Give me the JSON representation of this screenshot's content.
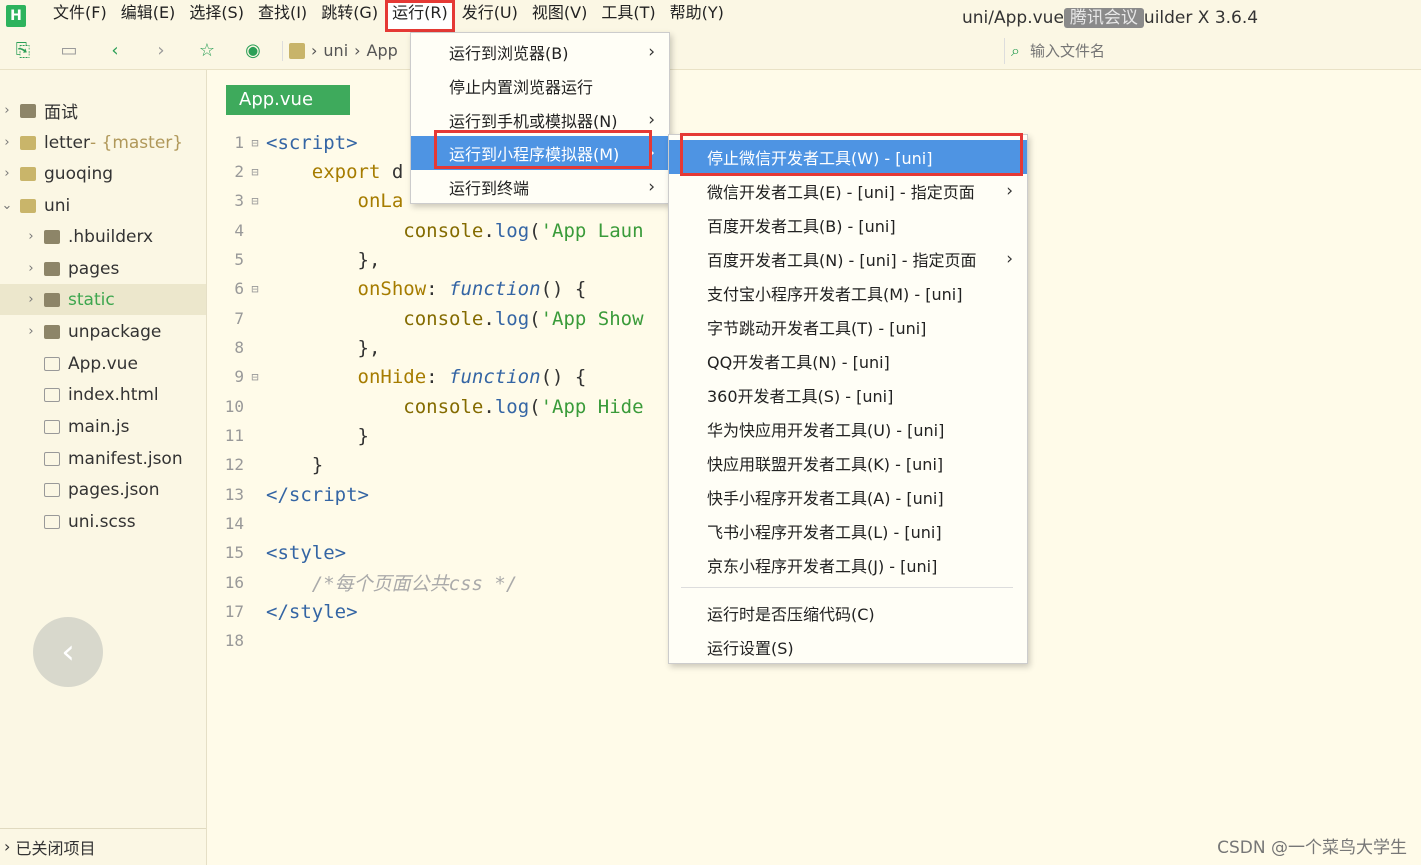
{
  "menubar": {
    "logo": "H",
    "items": [
      "文件(F)",
      "编辑(E)",
      "选择(S)",
      "查找(I)",
      "跳转(G)",
      "运行(R)",
      "发行(U)",
      "视图(V)",
      "工具(T)",
      "帮助(Y)"
    ],
    "title_prefix": "uni/App.vue",
    "title_overlay": "腾讯会议",
    "title_suffix": "uilder X 3.6.4"
  },
  "toolbar": {
    "breadcrumb": [
      "uni",
      "App"
    ],
    "search_placeholder": "输入文件名"
  },
  "sidebar": {
    "rows": [
      {
        "label": "面试",
        "sub": "",
        "type": "folder"
      },
      {
        "label": "letter",
        "sub": " - {master}",
        "type": "project"
      },
      {
        "label": "guoqing",
        "sub": "",
        "type": "project"
      },
      {
        "label": "uni",
        "sub": "",
        "type": "project"
      },
      {
        "label": ".hbuilderx",
        "sub": "",
        "type": "folder"
      },
      {
        "label": "pages",
        "sub": "",
        "type": "folder"
      },
      {
        "label": "static",
        "sub": "",
        "type": "folder"
      },
      {
        "label": "unpackage",
        "sub": "",
        "type": "folder"
      },
      {
        "label": "App.vue",
        "sub": "",
        "type": "file"
      },
      {
        "label": "index.html",
        "sub": "",
        "type": "file"
      },
      {
        "label": "main.js",
        "sub": "",
        "type": "file"
      },
      {
        "label": "manifest.json",
        "sub": "",
        "type": "file"
      },
      {
        "label": "pages.json",
        "sub": "",
        "type": "file"
      },
      {
        "label": "uni.scss",
        "sub": "",
        "type": "file"
      }
    ],
    "closed_projects": "已关闭项目"
  },
  "editor": {
    "tab": "App.vue",
    "line_numbers": [
      "1",
      "2",
      "3",
      "4",
      "5",
      "6",
      "7",
      "8",
      "9",
      "10",
      "11",
      "12",
      "13",
      "14",
      "15",
      "16",
      "17",
      "18"
    ]
  },
  "run_menu": {
    "items": [
      "运行到浏览器(B)",
      "停止内置浏览器运行",
      "运行到手机或模拟器(N)",
      "运行到小程序模拟器(M)",
      "运行到终端"
    ]
  },
  "miniprogram_menu": {
    "items": [
      "停止微信开发者工具(W) - [uni]",
      "微信开发者工具(E) - [uni] - 指定页面",
      "百度开发者工具(B) - [uni]",
      "百度开发者工具(N) - [uni] - 指定页面",
      "支付宝小程序开发者工具(M) - [uni]",
      "字节跳动开发者工具(T) - [uni]",
      "QQ开发者工具(N) - [uni]",
      "360开发者工具(S) - [uni]",
      "华为快应用开发者工具(U) - [uni]",
      "快应用联盟开发者工具(K) - [uni]",
      "快手小程序开发者工具(A) - [uni]",
      "飞书小程序开发者工具(L) - [uni]",
      "京东小程序开发者工具(J) - [uni]"
    ],
    "settings": [
      "运行时是否压缩代码(C)",
      "运行设置(S)"
    ]
  },
  "watermark": "CSDN @一个菜鸟大学生",
  "colors": {
    "accent_green": "#3eaa5c",
    "highlight_blue": "#4e94e3",
    "annotation_red": "#e53935"
  }
}
